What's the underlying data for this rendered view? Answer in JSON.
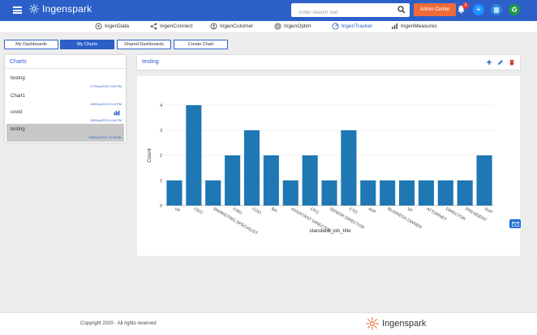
{
  "header": {
    "app_name": "Ingenspark",
    "search_placeholder": "Enter Search Text",
    "admin_label": "Admin Center",
    "notification_count": "0",
    "brand_color": "#2c60c8"
  },
  "modules": [
    {
      "label": "IngenData",
      "icon": "database-icon"
    },
    {
      "label": "IngenConnect",
      "icon": "share-icon"
    },
    {
      "label": "IngenCutomer",
      "icon": "customer-icon"
    },
    {
      "label": "IngenOptim",
      "icon": "target-icon"
    },
    {
      "label": "IngenTracker",
      "icon": "tracker-icon",
      "active": true
    },
    {
      "label": "IngenMeasures",
      "icon": "measures-icon"
    }
  ],
  "subtabs": [
    {
      "label": "My Dashboards"
    },
    {
      "label": "My Charts",
      "active": true
    },
    {
      "label": "Shared Dashboards"
    },
    {
      "label": "Create Chart"
    }
  ],
  "charts_panel": {
    "title": "Charts",
    "items": [
      {
        "name": "testing",
        "date": "27/Sep/2020 4:30 PM"
      },
      {
        "name": "Chart1",
        "date": "28/Sep/2020 3:13 PM"
      },
      {
        "name": "covid",
        "date": "28/Sep/2020 4:46 PM",
        "icon": "bar-chart-icon"
      },
      {
        "name": "testing",
        "date": "28/Sep/2020 12:18 AM",
        "selected": true
      }
    ]
  },
  "chart_view": {
    "title": "testing"
  },
  "chart_data": {
    "type": "bar",
    "categories": [
      "VP",
      "CEO",
      "MARKETING SPECIALIST",
      "CMO",
      "COO",
      "BA",
      "ASSISTANT DIRECTOR",
      "CFO",
      "SENIOR DIRECTOR",
      "CTO",
      "AVP",
      "BUSINESS OWNER",
      "VP",
      "ATTORNEY",
      "DIRECTOR",
      "PRESIDENT",
      "SVP"
    ],
    "values": [
      1,
      4,
      1,
      2,
      3,
      2,
      1,
      2,
      1,
      3,
      1,
      1,
      1,
      1,
      1,
      1,
      2
    ],
    "xlabel": "standard_job_title",
    "ylabel": "Count",
    "ylim": [
      0,
      4
    ],
    "yticks": [
      0,
      1,
      2,
      3,
      4
    ],
    "grid": true,
    "bar_color": "#1f77b4"
  },
  "footer": {
    "copyright": "Copyright 2020 · All rights reserved",
    "logo_text": "Ingenspark"
  }
}
